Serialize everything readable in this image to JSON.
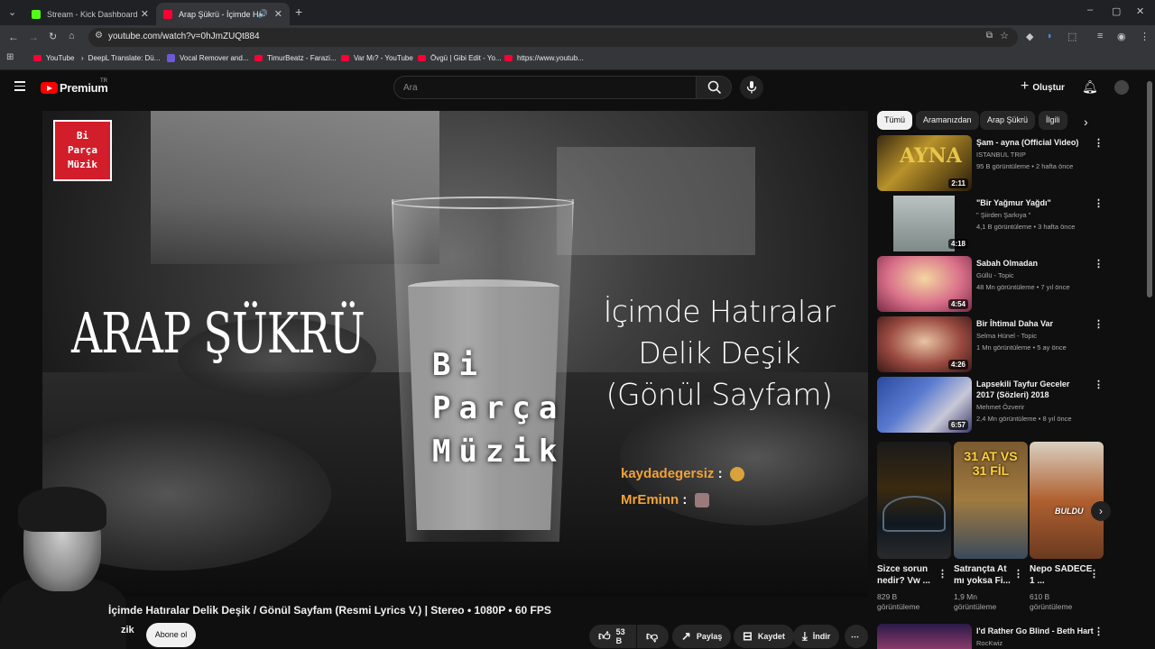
{
  "browser": {
    "tabs": [
      {
        "label": "Stream - Kick Dashboard",
        "favicon_color": "#53fc18"
      },
      {
        "label": "Arap Şükrü - İçimde Hatıral",
        "favicon_color": "#ff0033"
      }
    ],
    "url": "youtube.com/watch?v=0hJmZUQt884",
    "bookmarks": [
      "YouTube",
      "DeepL Translate: Dü...",
      "Vocal Remover and...",
      "TimurBeatz - Farazi...",
      "Var Mı? - YouTube",
      "Övgü | Gibi Edit - Yo...",
      "https://www.youtub..."
    ]
  },
  "youtube": {
    "logo_text": "Premium",
    "logo_sup": "TR",
    "search_placeholder": "Ara",
    "create_label": "Oluştur"
  },
  "video": {
    "logo_lines": [
      "Bi",
      "Parça",
      "Müzik"
    ],
    "artist": "ARAP ŞÜKRÜ",
    "center_lines": [
      "Bi",
      "Parça",
      "Müzik"
    ],
    "song_lines": [
      "İçimde Hatıralar",
      "Delik Deşik",
      "(Gönül Sayfam)"
    ],
    "chat": [
      {
        "user": "kaydadegersiz",
        "colon": ":"
      },
      {
        "user": "MrEminn",
        "colon": ":"
      }
    ]
  },
  "below_video": {
    "title": "İçimde Hatıralar Delik Deşik / Gönül Sayfam (Resmi Lyrics V.) | Stereo • 1080P • 60 FPS",
    "channel_fragment": "zik",
    "subscribe": "Abone ol",
    "likes": "53 B",
    "share": "Paylaş",
    "save": "Kaydet",
    "download": "İndir"
  },
  "chips": [
    "Tümü",
    "Aramanızdan",
    "Arap Şükrü",
    "İlgili"
  ],
  "recommended": [
    {
      "title": "Şam - ayna (Official Video)",
      "channel": "ISTANBUL TRIP",
      "meta": "95 B görüntüleme • 2 hafta önce",
      "duration": "2:11"
    },
    {
      "title": "\"Bir Yağmur Yağdı\"",
      "channel": "\" Şiirden Şarkıya \"",
      "meta": "4,1 B görüntüleme • 3 hafta önce",
      "duration": "4:18"
    },
    {
      "title": "Sabah Olmadan",
      "channel": "Güllü - Topic",
      "meta": "48 Mn görüntüleme • 7 yıl önce",
      "duration": "4:54"
    },
    {
      "title": "Bir İhtimal Daha Var",
      "channel": "Selma Hünel - Topic",
      "meta": "1 Mn görüntüleme • 5 ay önce",
      "duration": "4:26"
    },
    {
      "title": "Lapsekili Tayfur Geceler 2017 (Sözleri) 2018",
      "channel": "Mehmet Özverir",
      "meta": "2,4 Mn görüntüleme • 8 yıl önce",
      "duration": "6:57"
    }
  ],
  "shorts": [
    {
      "title": "Sizce sorun nedir? Vw ...",
      "views": "829 B",
      "views_label": "görüntüleme",
      "overlay": ""
    },
    {
      "title": "Satrançta At mı yoksa Fi...",
      "views": "1,9 Mn",
      "views_label": "görüntüleme",
      "overlay": "31 AT VS 31 FİL"
    },
    {
      "title": "Nepo SADECE 1 ...",
      "views": "610 B",
      "views_label": "görüntüleme",
      "overlay": "BULDU"
    }
  ],
  "last_item": {
    "title": "I'd Rather Go Blind - Beth Hart",
    "channel": "RocKwiz"
  }
}
